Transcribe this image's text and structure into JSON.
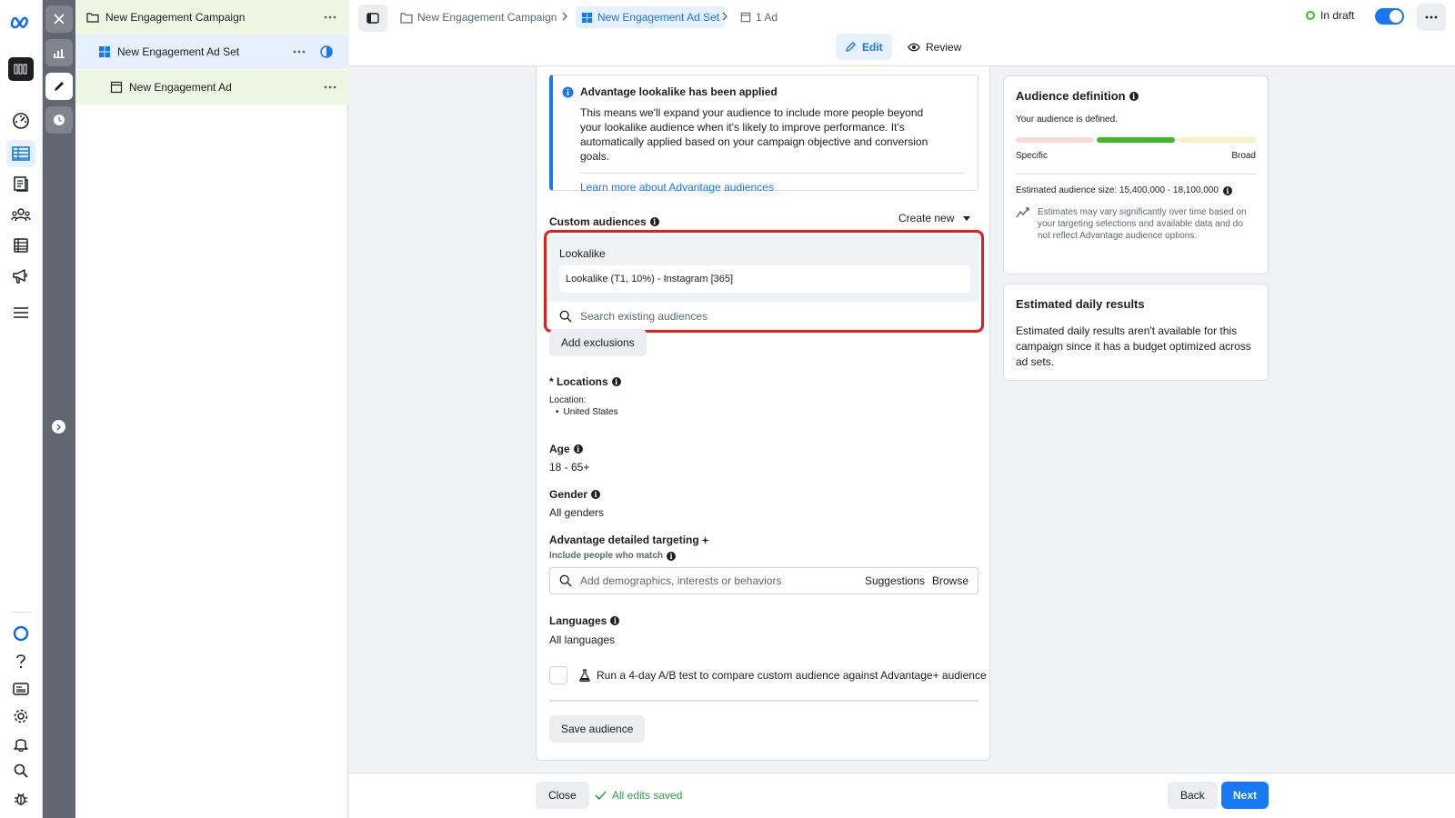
{
  "tree": {
    "campaign": "New Engagement Campaign",
    "adset": "New Engagement Ad Set",
    "ad": "New Engagement Ad"
  },
  "breadcrumb": {
    "campaign": "New Engagement Campaign",
    "adset": "New Engagement Ad Set",
    "ad": "1 Ad"
  },
  "status": {
    "label": "In draft"
  },
  "mode": {
    "edit": "Edit",
    "review": "Review"
  },
  "advantage_notice": {
    "title": "Advantage lookalike has been applied",
    "body": "This means we'll expand your audience to include more people beyond your lookalike audience when it's likely to improve performance. It's automatically applied based on your campaign objective and conversion goals.",
    "link": "Learn more about Advantage audiences"
  },
  "custom_audiences": {
    "label": "Custom audiences",
    "create_new": "Create new",
    "group_title": "Lookalike",
    "selected": "Lookalike (T1, 10%) - Instagram [365]",
    "search_placeholder": "Search existing audiences",
    "add_exclusions": "Add exclusions"
  },
  "locations": {
    "label": "* Locations",
    "sub": "Location:",
    "value": "United States"
  },
  "age": {
    "label": "Age",
    "value": "18 - 65+"
  },
  "gender": {
    "label": "Gender",
    "value": "All genders"
  },
  "detailed_targeting": {
    "label": "Advantage detailed targeting",
    "sub": "Include people who match",
    "placeholder": "Add demographics, interests or behaviors",
    "suggestions": "Suggestions",
    "browse": "Browse"
  },
  "languages": {
    "label": "Languages",
    "value": "All languages"
  },
  "ab_test": {
    "label": "Run a 4-day A/B test to compare custom audience against Advantage+ audience"
  },
  "save_audience": "Save audience",
  "audience_definition": {
    "title": "Audience definition",
    "defined": "Your audience is defined.",
    "specific": "Specific",
    "broad": "Broad",
    "size_label": "Estimated audience size: 15,400,000 - 18,100,000",
    "note": "Estimates may vary significantly over time based on your targeting selections and available data and do not reflect Advantage audience options."
  },
  "daily_results": {
    "title": "Estimated daily results",
    "body": "Estimated daily results aren't available for this campaign since it has a budget optimized across ad sets."
  },
  "bottom": {
    "close": "Close",
    "saved": "All edits saved",
    "back": "Back",
    "next": "Next"
  },
  "colors": {
    "accent": "#1877f2",
    "highlight_border": "#e02020",
    "success": "#31a24c"
  }
}
